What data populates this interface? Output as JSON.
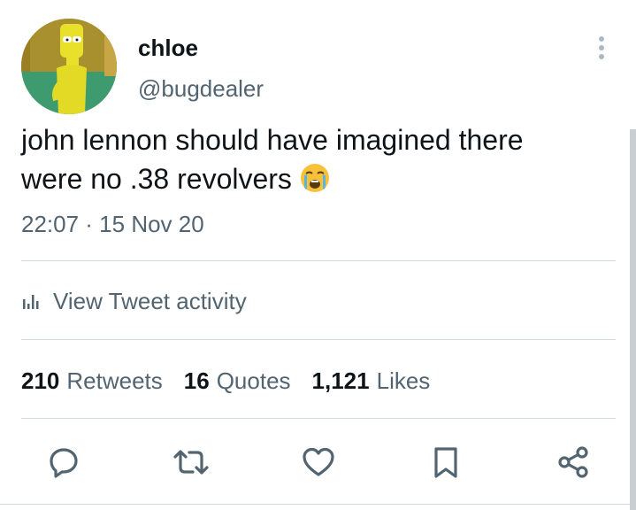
{
  "author": {
    "display_name": "chloe",
    "handle": "@bugdealer",
    "avatar_icon": "cartoon-character-avatar"
  },
  "tweet": {
    "text": "john lennon should have imagined there\nwere no .38 revolvers",
    "emoji_icon": "loudly-crying-face-emoji",
    "timestamp": "22:07 · 15 Nov 20"
  },
  "activity": {
    "label": "View Tweet activity",
    "icon": "analytics-bars-icon"
  },
  "stats": [
    {
      "count": "210",
      "label": "Retweets"
    },
    {
      "count": "16",
      "label": "Quotes"
    },
    {
      "count": "1,121",
      "label": "Likes"
    }
  ],
  "actions": [
    {
      "name": "reply",
      "icon": "reply-bubble-icon"
    },
    {
      "name": "retweet",
      "icon": "retweet-icon"
    },
    {
      "name": "like",
      "icon": "heart-icon"
    },
    {
      "name": "bookmark",
      "icon": "bookmark-icon"
    },
    {
      "name": "share",
      "icon": "share-icon"
    }
  ],
  "colors": {
    "text_primary": "#0f1419",
    "text_secondary": "#536471",
    "divider": "#cfd9de"
  }
}
